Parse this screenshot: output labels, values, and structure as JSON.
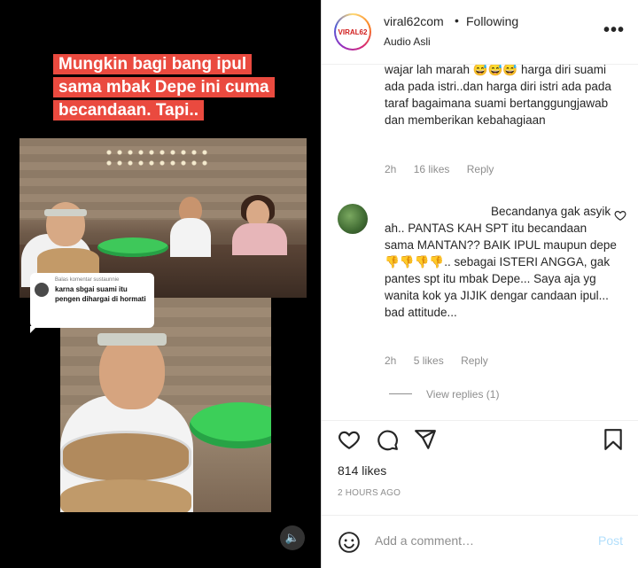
{
  "media": {
    "caption": "Mungkin bagi bang ipul sama mbak Depe ini cuma becandaan. Tapi..",
    "overlay_comment": {
      "meta": "Balas komentar sustaunnie",
      "text": "karna sbgai suami itu pengen dihargai di hormati"
    },
    "volume_icon": "🔈"
  },
  "header": {
    "username": "viral62com",
    "separator": "•",
    "following": "Following",
    "audio": "Audio Asli",
    "avatar_text": "VIRAL62",
    "more_icon": "•••"
  },
  "comments": [
    {
      "text": "wajar lah marah 😅😅😅 harga diri suami ada pada istri..dan harga diri istri ada pada taraf bagaimana suami bertanggungjawab dan memberikan kebahagiaan",
      "time": "2h",
      "likes": "16 likes",
      "reply": "Reply"
    },
    {
      "text": "Becandanya gak asyik ah.. PANTAS KAH SPT itu becandaan sama MANTAN?? BAIK IPUL maupun depe 👎👎👎👎.. sebagai ISTERI ANGGA, gak pantes spt itu mbak Depe... Saya aja yg wanita kok ya JIJIK dengar candaan ipul... bad attitude...",
      "time": "2h",
      "likes": "5 likes",
      "reply": "Reply",
      "view_replies": "View replies (1)"
    }
  ],
  "footer": {
    "likes": "814 likes",
    "time": "2 HOURS AGO",
    "comment_placeholder": "Add a comment…",
    "post_label": "Post"
  },
  "colors": {
    "caption_bg": "#ea4a3f",
    "post_disabled": "#b2dffc"
  }
}
